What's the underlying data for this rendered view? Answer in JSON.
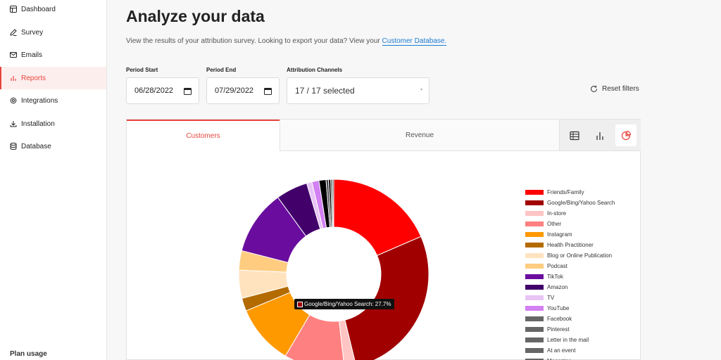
{
  "sidebar": {
    "items": [
      {
        "label": "Dashboard",
        "icon": "layout-icon",
        "active": false
      },
      {
        "label": "Survey",
        "icon": "pencil-icon",
        "active": false
      },
      {
        "label": "Emails",
        "icon": "mail-icon",
        "active": false
      },
      {
        "label": "Reports",
        "icon": "bar-chart-icon",
        "active": true
      },
      {
        "label": "Integrations",
        "icon": "gear-icon",
        "active": false
      },
      {
        "label": "Installation",
        "icon": "download-icon",
        "active": false
      },
      {
        "label": "Database",
        "icon": "database-icon",
        "active": false
      }
    ],
    "plan_usage": "Plan usage"
  },
  "header": {
    "title": "Analyze your data",
    "subtitle_text": "View the results of your attribution survey. Looking to export your data? View your ",
    "subtitle_link": "Customer Database."
  },
  "filters": {
    "period_start_label": "Period Start",
    "period_start_value": "06/28/2022",
    "period_end_label": "Period End",
    "period_end_value": "07/29/2022",
    "channels_label": "Attribution Channels",
    "channels_value": "17 / 17 selected",
    "reset_label": "Reset filters"
  },
  "tabs": [
    {
      "label": "Customers",
      "active": true
    },
    {
      "label": "Revenue",
      "active": false
    }
  ],
  "view_modes": [
    {
      "icon": "table-icon",
      "active": false
    },
    {
      "icon": "bar-chart-icon",
      "active": false
    },
    {
      "icon": "pie-chart-icon",
      "active": true
    }
  ],
  "accent_color": "#e8453c",
  "tooltip": {
    "text": "Google/Bing/Yahoo Search: 27.7%"
  },
  "chart_data": {
    "type": "pie",
    "variant": "donut",
    "legend_position": "right",
    "series": [
      {
        "name": "Friends/Family",
        "value": 18.5,
        "color": "#ff0000"
      },
      {
        "name": "Google/Bing/Yahoo Search",
        "value": 27.7,
        "color": "#a00000"
      },
      {
        "name": "In-store",
        "value": 2.0,
        "color": "#ffc4c4"
      },
      {
        "name": "Other",
        "value": 10.3,
        "color": "#ff8080"
      },
      {
        "name": "Instagram",
        "value": 10.2,
        "color": "#ff9900"
      },
      {
        "name": "Health Practitioner",
        "value": 2.2,
        "color": "#b36b00"
      },
      {
        "name": "Blog or Online Publication",
        "value": 4.8,
        "color": "#ffe3bf"
      },
      {
        "name": "Podcast",
        "value": 3.3,
        "color": "#ffcc80"
      },
      {
        "name": "TikTok",
        "value": 11.0,
        "color": "#6a0d9e"
      },
      {
        "name": "Amazon",
        "value": 5.4,
        "color": "#42006b"
      },
      {
        "name": "TV",
        "value": 0.9,
        "color": "#e8c4f5"
      },
      {
        "name": "YouTube",
        "value": 1.2,
        "color": "#d280f2"
      },
      {
        "name": "Facebook",
        "value": 1.2,
        "color": "#000000"
      },
      {
        "name": "Pinterest",
        "value": 0.4,
        "color": "#444444"
      },
      {
        "name": "Letter in the mail",
        "value": 0.4,
        "color": "#111111"
      },
      {
        "name": "At an event",
        "value": 0.3,
        "color": "#555555"
      },
      {
        "name": "Magazine",
        "value": 0.2,
        "color": "#222222"
      }
    ],
    "legend_swatch_colors": [
      "#ff0000",
      "#a00000",
      "#ffc4c4",
      "#ff8080",
      "#ff9900",
      "#b36b00",
      "#ffe3bf",
      "#ffcc80",
      "#6a0d9e",
      "#42006b",
      "#e8c4f5",
      "#d280f2",
      "#666666",
      "#666666",
      "#666666",
      "#666666",
      "#666666"
    ]
  }
}
